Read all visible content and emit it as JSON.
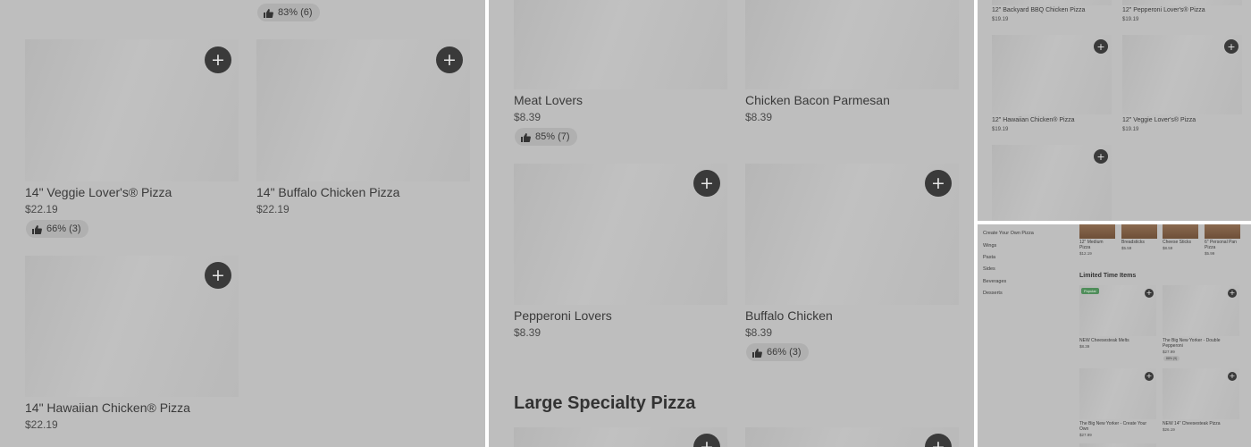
{
  "panel1": {
    "top_rating": "83% (6)",
    "items": [
      {
        "name": "14\" Veggie Lover's® Pizza",
        "price": "$22.19",
        "rating": "66% (3)"
      },
      {
        "name": "14\" Buffalo Chicken Pizza",
        "price": "$22.19"
      },
      {
        "name": "14\" Hawaiian Chicken® Pizza",
        "price": "$22.19"
      }
    ]
  },
  "panel2": {
    "items": [
      {
        "name": "Meat Lovers",
        "price": "$8.39",
        "rating": "85% (7)"
      },
      {
        "name": "Chicken Bacon Parmesan",
        "price": "$8.39"
      },
      {
        "name": "Pepperoni Lovers",
        "price": "$8.39"
      },
      {
        "name": "Buffalo Chicken",
        "price": "$8.39",
        "rating": "66% (3)"
      }
    ],
    "section_title": "Large Specialty Pizza"
  },
  "panel3": {
    "items": [
      {
        "name": "12\" Backyard BBQ Chicken Pizza",
        "price": "$19.19"
      },
      {
        "name": "12\" Pepperoni Lover's® Pizza",
        "price": "$19.19"
      },
      {
        "name": "12\" Hawaiian Chicken® Pizza",
        "price": "$19.19"
      },
      {
        "name": "12\" Veggie Lover's® Pizza",
        "price": "$19.19"
      }
    ]
  },
  "panel4": {
    "nav": [
      "Create Your Own Pizza",
      "Wings",
      "Pasta",
      "Sides",
      "Beverages",
      "Desserts"
    ],
    "top_items": [
      {
        "name": "12\" Medium Pizza",
        "price": "$12.19"
      },
      {
        "name": "Breadsticks",
        "price": "$5.59"
      },
      {
        "name": "Cheese Sticks",
        "price": "$8.59"
      },
      {
        "name": "6\" Personal Pan Pizza",
        "price": "$5.99"
      }
    ],
    "section_title": "Limited Time Items",
    "popular_label": "Popular",
    "items": [
      {
        "name": "NEW Cheesesteak Melts",
        "price": "$8.39"
      },
      {
        "name": "The Big New Yorker - Double Pepperoni",
        "price": "$27.99",
        "rating": "88% (9)"
      },
      {
        "name": "The Big New Yorker - Create Your Own",
        "price": "$27.99"
      },
      {
        "name": "NEW 14\" Cheesesteak Pizza",
        "price": "$26.19"
      }
    ]
  },
  "icons": {
    "add": "plus-icon",
    "rating": "thumbs-up-icon"
  },
  "colors": {
    "overlay": "#bebebe",
    "add_button": "#3a3a3a",
    "popular_badge": "#4f8d5a"
  }
}
